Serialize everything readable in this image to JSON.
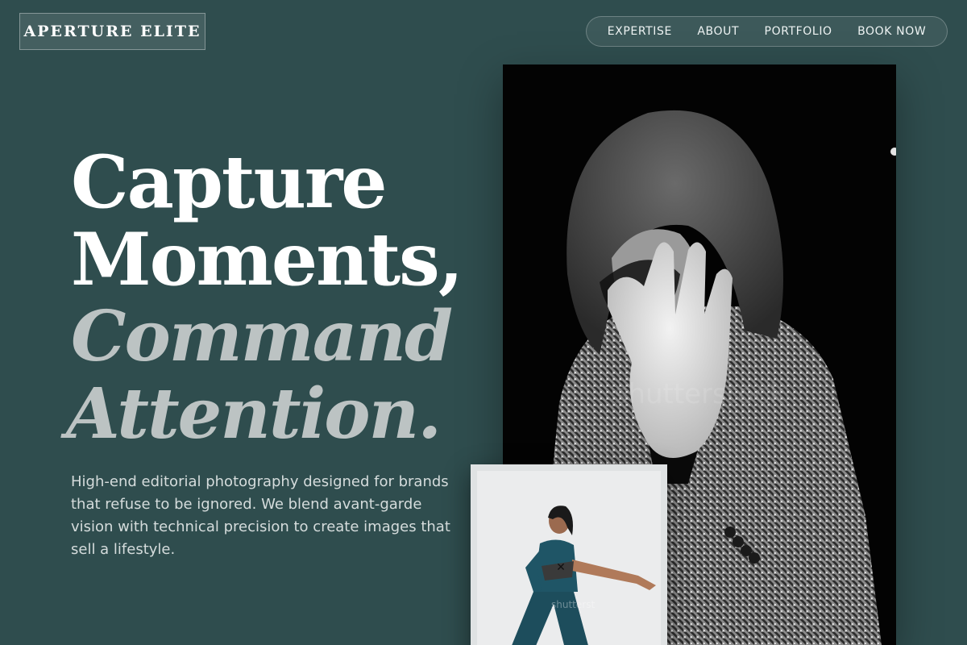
{
  "brand": {
    "name": "APERTURE ELITE"
  },
  "nav": {
    "items": [
      {
        "label": "EXPERTISE"
      },
      {
        "label": "ABOUT"
      },
      {
        "label": "PORTFOLIO"
      },
      {
        "label": "BOOK NOW"
      }
    ]
  },
  "hero": {
    "headline_line1": "Capture",
    "headline_line2": "Moments,",
    "headline_line3": "Command",
    "headline_line4": "Attention.",
    "description": "High-end editorial photography designed for brands that refuse to be ignored. We blend avant-garde vision with technical precision to create images that sell a lifestyle."
  },
  "images": {
    "main_watermark": "shutterstock",
    "small_watermark": "shutterst"
  },
  "colors": {
    "background": "#2f4d4e",
    "accent_text": "#bcc3c3",
    "body_text": "#d5dcdc"
  }
}
